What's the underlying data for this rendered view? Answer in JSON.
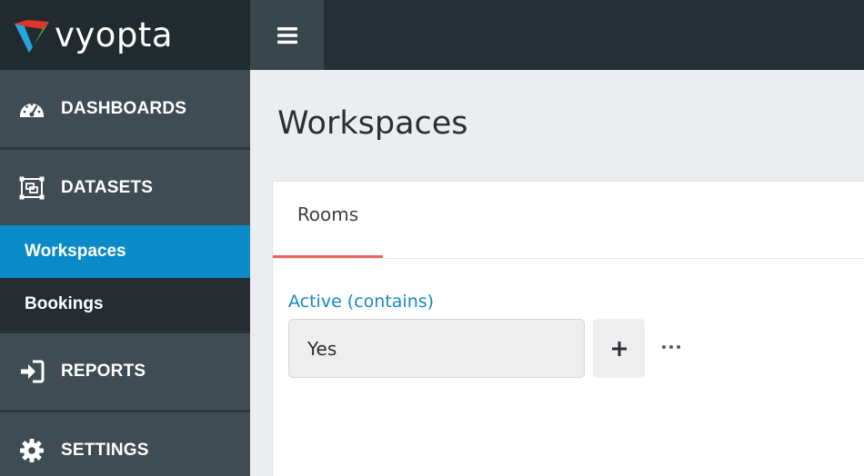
{
  "brand": {
    "name": "vyopta",
    "logo_icon": "vyopta-logo-mark"
  },
  "topbar": {
    "menu_icon": "hamburger-icon"
  },
  "sidebar": {
    "sections": [
      {
        "label": "DASHBOARDS",
        "icon": "speedometer-icon"
      },
      {
        "label": "DATASETS",
        "icon": "dataset-icon"
      },
      {
        "label": "REPORTS",
        "icon": "sign-in-icon"
      },
      {
        "label": "SETTINGS",
        "icon": "gear-icon"
      }
    ],
    "dataset_items": [
      {
        "label": "Workspaces",
        "active": true
      },
      {
        "label": "Bookings",
        "active": false
      }
    ]
  },
  "main": {
    "title": "Workspaces",
    "tabs": [
      {
        "label": "Rooms",
        "active": true
      }
    ],
    "filter": {
      "label": "Active (contains)",
      "value": "Yes",
      "add_icon": "plus-icon",
      "more_icon": "ellipsis-icon"
    }
  },
  "colors": {
    "accent_blue": "#0a8bc7",
    "tab_underline": "#e8665f",
    "sidebar_bg": "#404c54",
    "topbar_bg": "#252f35"
  }
}
